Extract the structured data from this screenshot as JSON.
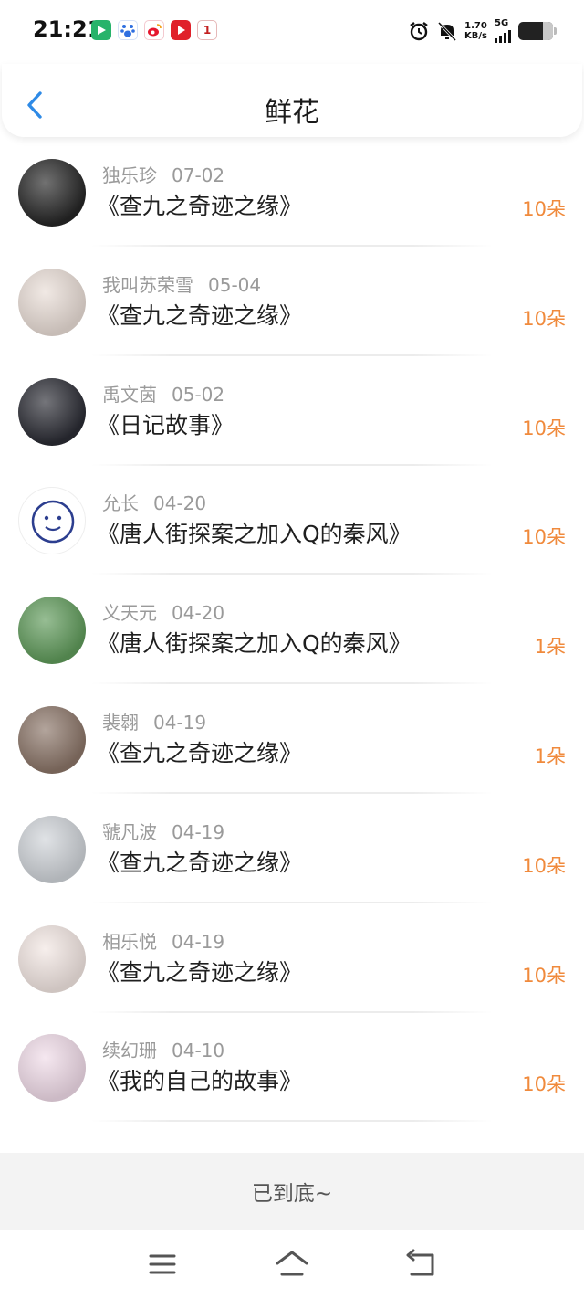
{
  "status_bar": {
    "time": "21:21",
    "apps": [
      {
        "icon": "video-app-icon",
        "color": "#27b36a"
      },
      {
        "icon": "baidu-icon",
        "color": "#2f6fe0"
      },
      {
        "icon": "weibo-icon",
        "color": "#e6162d"
      },
      {
        "icon": "video-red-icon",
        "color": "#e0202a"
      },
      {
        "icon": "notification-1-icon",
        "color": "#ffffff",
        "label": "1"
      }
    ],
    "net_speed": "1.70",
    "net_unit": "KB/s",
    "net_type": "5G",
    "battery_level": 0.7
  },
  "header": {
    "title": "鲜花",
    "back_icon": "chevron-left-icon",
    "accent": "#2e8ae6"
  },
  "partial_row": {
    "count": "1"
  },
  "rows": [
    {
      "name": "独乐珍",
      "date": "07-02",
      "work": "《查九之奇迹之缘》",
      "count": "10朵",
      "avatar_bg": "#262626"
    },
    {
      "name": "我叫苏荣雪",
      "date": "05-04",
      "work": "《查九之奇迹之缘》",
      "count": "10朵",
      "avatar_bg": "#e9ddd6"
    },
    {
      "name": "禹文茵",
      "date": "05-02",
      "work": "《日记故事》",
      "count": "10朵",
      "avatar_bg": "#2a2b33"
    },
    {
      "name": "允长",
      "date": "04-20",
      "work": "《唐人街探案之加入Q的秦风》",
      "count": "10朵",
      "avatar_bg": "#ffffff"
    },
    {
      "name": "义天元",
      "date": "04-20",
      "work": "《唐人街探案之加入Q的秦风》",
      "count": "1朵",
      "avatar_bg": "#5f9a5a"
    },
    {
      "name": "裴翱",
      "date": "04-19",
      "work": "《查九之奇迹之缘》",
      "count": "1朵",
      "avatar_bg": "#8a7467"
    },
    {
      "name": "虢凡波",
      "date": "04-19",
      "work": "《查九之奇迹之缘》",
      "count": "10朵",
      "avatar_bg": "#cfd3d8"
    },
    {
      "name": "相乐悦",
      "date": "04-19",
      "work": "《查九之奇迹之缘》",
      "count": "10朵",
      "avatar_bg": "#f2e6e2"
    },
    {
      "name": "续幻珊",
      "date": "04-10",
      "work": "《我的自己的故事》",
      "count": "10朵",
      "avatar_bg": "#f0dbe8"
    }
  ],
  "footer_note": "已到底~",
  "nav": {
    "menu_icon": "menu-icon",
    "home_icon": "home-icon",
    "back_icon": "back-arrow-icon"
  },
  "colors": {
    "count": "#f08a3c",
    "meta": "#9a9a9a",
    "footer_bg": "#f3f3f3"
  }
}
